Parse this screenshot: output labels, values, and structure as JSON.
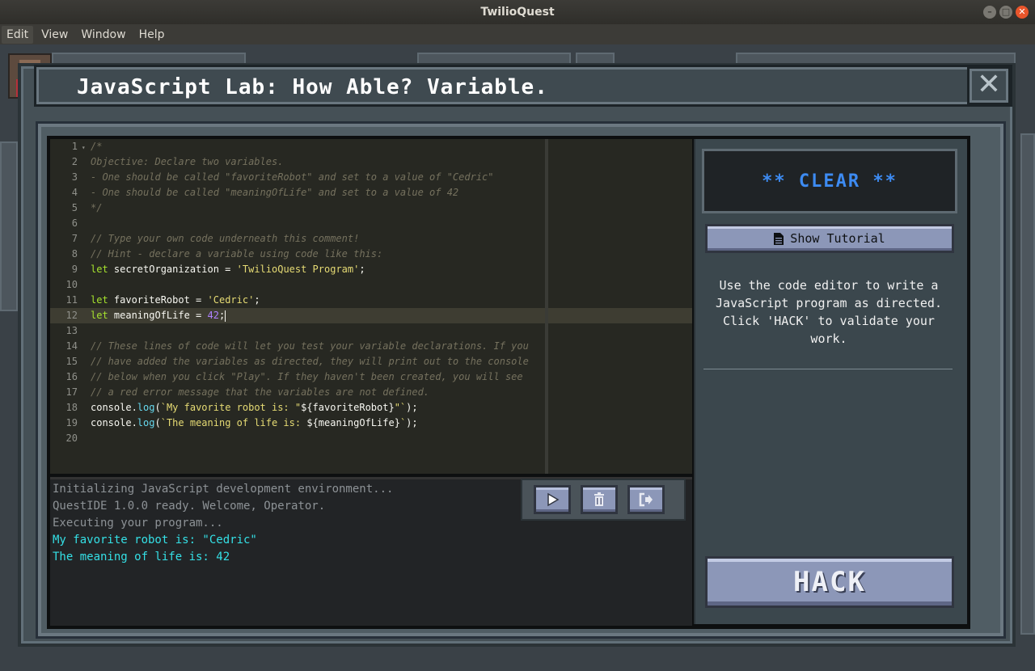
{
  "window": {
    "title": "TwilioQuest",
    "buttons": [
      "minimize",
      "maximize",
      "close"
    ]
  },
  "menubar": {
    "items": [
      {
        "label": "Edit",
        "active": true
      },
      {
        "label": "View",
        "active": false
      },
      {
        "label": "Window",
        "active": false
      },
      {
        "label": "Help",
        "active": false
      }
    ]
  },
  "modal": {
    "title": "JavaScript Lab: How Able? Variable.",
    "close_label": "✕"
  },
  "editor": {
    "lines": [
      {
        "n": "1",
        "fold": true,
        "tokens": [
          [
            "c-comment",
            "/*"
          ]
        ]
      },
      {
        "n": "2",
        "tokens": [
          [
            "c-comment",
            "Objective: Declare two variables."
          ]
        ]
      },
      {
        "n": "3",
        "tokens": [
          [
            "c-comment",
            "- One should be called \"favoriteRobot\" and set to a value of \"Cedric\""
          ]
        ]
      },
      {
        "n": "4",
        "tokens": [
          [
            "c-comment",
            "- One should be called \"meaningOfLife\" and set to a value of 42"
          ]
        ]
      },
      {
        "n": "5",
        "tokens": [
          [
            "c-comment",
            "*/"
          ]
        ]
      },
      {
        "n": "6",
        "tokens": []
      },
      {
        "n": "7",
        "tokens": [
          [
            "c-comment",
            "// Type your own code underneath this comment!"
          ]
        ]
      },
      {
        "n": "8",
        "tokens": [
          [
            "c-comment",
            "// Hint - declare a variable using code like this:"
          ]
        ]
      },
      {
        "n": "9",
        "tokens": [
          [
            "c-kw",
            "let"
          ],
          [
            "c-plain",
            " secretOrganization = "
          ],
          [
            "c-str",
            "'TwilioQuest Program'"
          ],
          [
            "c-plain",
            ";"
          ]
        ]
      },
      {
        "n": "10",
        "tokens": []
      },
      {
        "n": "11",
        "tokens": [
          [
            "c-kw",
            "let"
          ],
          [
            "c-plain",
            " favoriteRobot = "
          ],
          [
            "c-str",
            "'Cedric'"
          ],
          [
            "c-plain",
            ";"
          ]
        ]
      },
      {
        "n": "12",
        "active": true,
        "tokens": [
          [
            "c-kw",
            "let"
          ],
          [
            "c-plain",
            " meaningOfLife = "
          ],
          [
            "c-num",
            "42"
          ],
          [
            "c-plain",
            ";"
          ]
        ]
      },
      {
        "n": "13",
        "tokens": []
      },
      {
        "n": "14",
        "tokens": [
          [
            "c-comment",
            "// These lines of code will let you test your variable declarations. If you"
          ]
        ]
      },
      {
        "n": "15",
        "tokens": [
          [
            "c-comment",
            "// have added the variables as directed, they will print out to the console"
          ]
        ]
      },
      {
        "n": "16",
        "tokens": [
          [
            "c-comment",
            "// below when you click \"Play\". If they haven't been created, you will see"
          ]
        ]
      },
      {
        "n": "17",
        "tokens": [
          [
            "c-comment",
            "// a red error message that the variables are not defined."
          ]
        ]
      },
      {
        "n": "18",
        "tokens": [
          [
            "c-plain",
            "console."
          ],
          [
            "c-fn",
            "log"
          ],
          [
            "c-plain",
            "("
          ],
          [
            "c-str",
            "`My favorite robot is: \""
          ],
          [
            "c-plain",
            "${favoriteRobot}"
          ],
          [
            "c-str",
            "\"`"
          ],
          [
            "c-plain",
            ");"
          ]
        ]
      },
      {
        "n": "19",
        "tokens": [
          [
            "c-plain",
            "console."
          ],
          [
            "c-fn",
            "log"
          ],
          [
            "c-plain",
            "("
          ],
          [
            "c-str",
            "`The meaning of life is: "
          ],
          [
            "c-plain",
            "${meaningOfLife}"
          ],
          [
            "c-str",
            "`"
          ],
          [
            "c-plain",
            ");"
          ]
        ]
      },
      {
        "n": "20",
        "tokens": []
      }
    ]
  },
  "console": {
    "lines": [
      {
        "kind": "system",
        "text": "Initializing JavaScript development environment..."
      },
      {
        "kind": "system",
        "text": "QuestIDE 1.0.0 ready. Welcome, Operator."
      },
      {
        "kind": "system",
        "text": "Executing your program..."
      },
      {
        "kind": "output",
        "text": "My favorite robot is: \"Cedric\""
      },
      {
        "kind": "output",
        "text": "The meaning of life is: 42"
      }
    ],
    "tools": [
      {
        "name": "play-button",
        "icon": "play-icon"
      },
      {
        "name": "clear-console-button",
        "icon": "trash-icon"
      },
      {
        "name": "exit-button",
        "icon": "sign-out-icon"
      }
    ]
  },
  "side_panel": {
    "status": "** CLEAR **",
    "status_color": "#3d8bf2",
    "tutorial_label": "Show Tutorial",
    "tutorial_icon": "document-icon",
    "instructions": "Use the code editor to write a JavaScript program as directed. Click 'HACK' to validate your work.",
    "hack_label": "HACK"
  }
}
